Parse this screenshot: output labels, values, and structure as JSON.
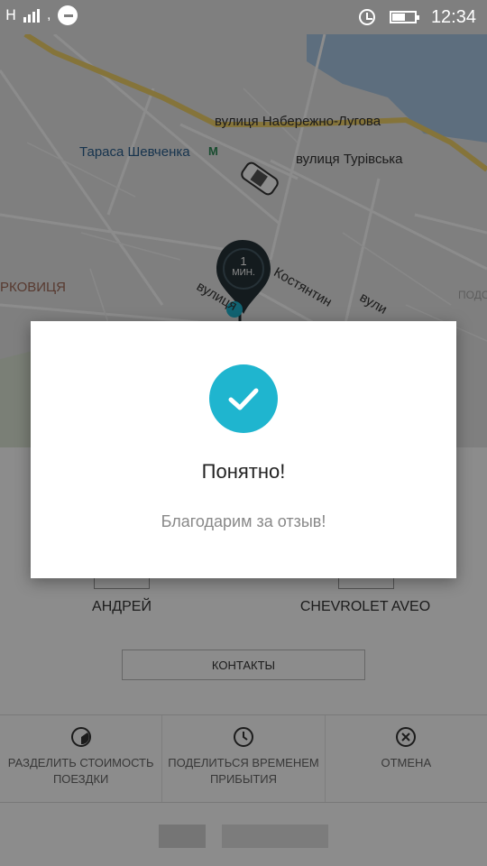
{
  "status_bar": {
    "network_letter": "H",
    "time": "12:34",
    "icons": [
      "signal-icon",
      "uber-app-icon",
      "alarm-icon",
      "battery-icon"
    ]
  },
  "map": {
    "labels": {
      "street_1": "вулиця Набережно-Лугова",
      "metro": "Тараса Шевченка",
      "metro_mark": "M",
      "street_2": "вулиця Турівська",
      "area": "РКОВИЦЯ",
      "street_3": "вулиця",
      "street_4": "Костянтин",
      "street_5": "вули",
      "street_6": "ПОДО"
    },
    "eta_marker": {
      "value": "1",
      "unit": "МИН."
    },
    "colors": {
      "road_main": "#f2d36b",
      "water": "#a9c9e6",
      "marker": "#263238",
      "pin": "#1fb5cf"
    }
  },
  "driver": {
    "name": "АНДРЕЙ"
  },
  "car": {
    "model": "CHEVROLET AVEO"
  },
  "contacts_label": "КОНТАКТЫ",
  "actions": [
    {
      "label": "РАЗДЕЛИТЬ СТОИМОСТЬ ПОЕЗДКИ",
      "icon": "split-fare-icon"
    },
    {
      "label": "ПОДЕЛИТЬСЯ ВРЕМЕНЕМ ПРИБЫТИЯ",
      "icon": "clock-icon"
    },
    {
      "label": "ОТМЕНА",
      "icon": "cancel-icon"
    }
  ],
  "dialog": {
    "icon": "check-icon",
    "title": "Понятно!",
    "message": "Благодарим за отзыв!",
    "accent": "#1fb5cf"
  }
}
